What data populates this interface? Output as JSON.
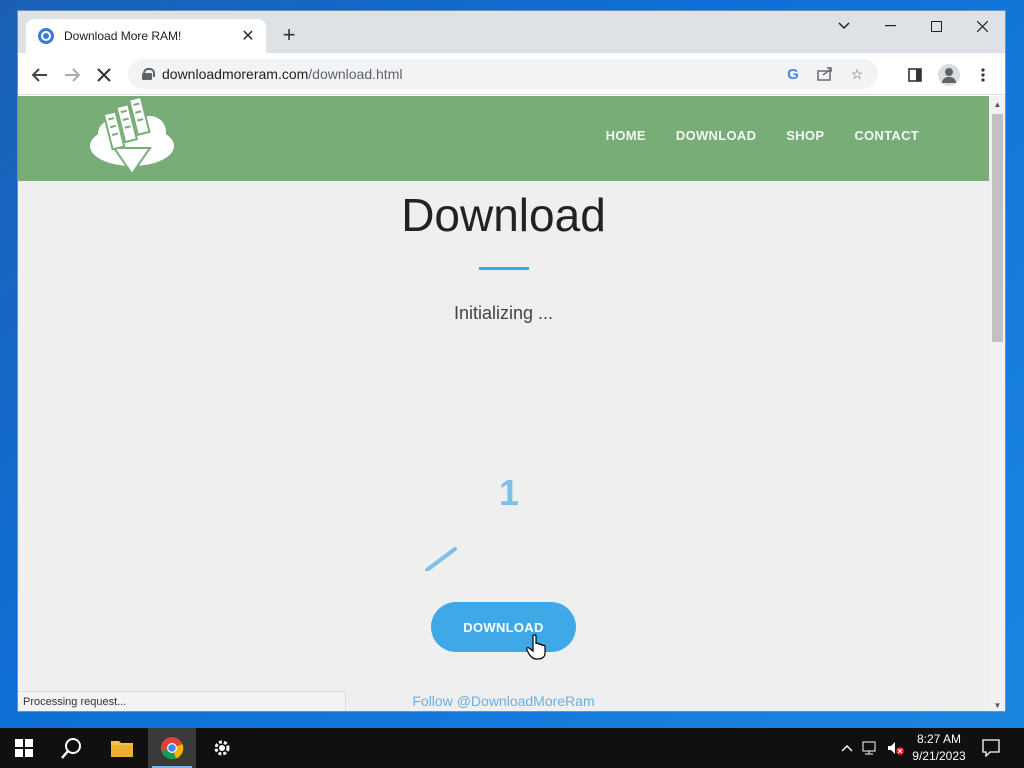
{
  "browser": {
    "tab_title": "Download More RAM!",
    "new_tab_label": "+",
    "url_domain": "downloadmoreram.com",
    "url_path": "/download.html",
    "status_text": "Processing request..."
  },
  "site": {
    "nav": [
      "HOME",
      "DOWNLOAD",
      "SHOP",
      "CONTACT"
    ],
    "title": "Download",
    "status": "Initializing ...",
    "countdown": "1",
    "download_label": "DOWNLOAD",
    "follow_text": "Follow @DownloadMoreRam",
    "colors": {
      "header": "#78ad78",
      "accent": "#3fa9e8",
      "rule": "#3fa9dd"
    }
  },
  "taskbar": {
    "time": "8:27 AM",
    "date": "9/21/2023",
    "apps": [
      "start-icon",
      "search-icon",
      "file-explorer-icon",
      "chrome-icon",
      "settings-icon"
    ]
  }
}
